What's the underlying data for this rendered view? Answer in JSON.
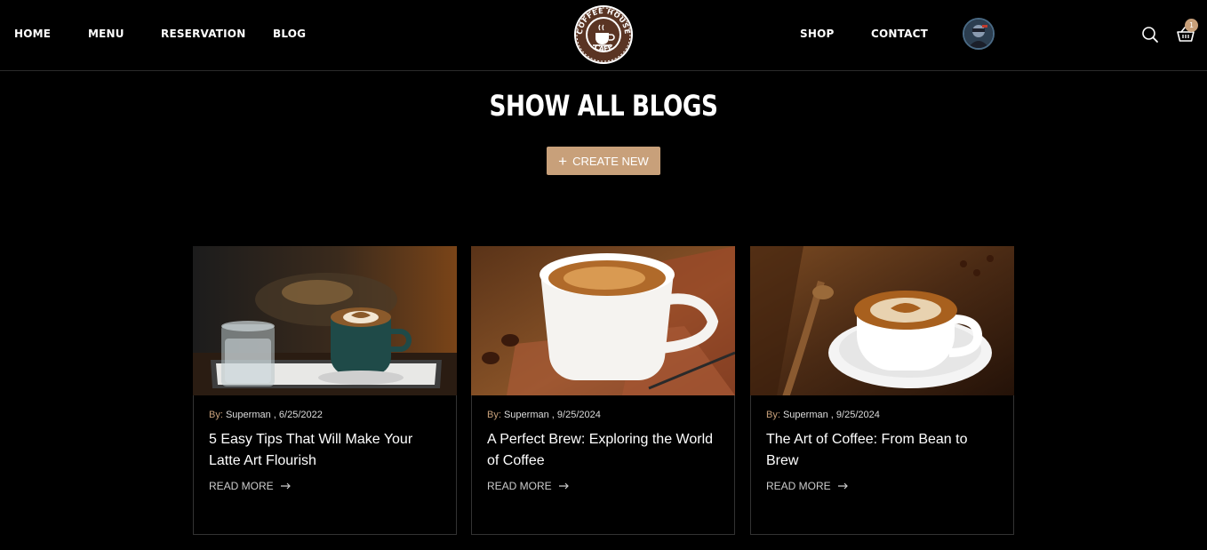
{
  "nav": {
    "left": [
      {
        "id": "home",
        "label": "HOME"
      },
      {
        "id": "menu",
        "label": "MENU"
      },
      {
        "id": "reservation",
        "label": "RESERVATION"
      },
      {
        "id": "blog",
        "label": "BLOG"
      }
    ],
    "right": [
      {
        "id": "shop",
        "label": "SHOP"
      },
      {
        "id": "contact",
        "label": "CONTACT"
      }
    ],
    "logo": {
      "top_text": "COFFEE HOUSE",
      "bottom_text": "CAFE"
    },
    "cart_count": "1",
    "icons": {
      "search": "search-icon",
      "cart": "cart-icon",
      "avatar": "avatar"
    }
  },
  "page": {
    "title": "SHOW ALL BLOGS",
    "create_button": "CREATE NEW",
    "create_icon": "+"
  },
  "blogs": [
    {
      "by_label": "By:",
      "author": "Superman",
      "date": "6/25/2022",
      "title": "5 Easy Tips That Will Make Your Latte Art Flourish",
      "read_more": "READ MORE"
    },
    {
      "by_label": "By:",
      "author": "Superman",
      "date": "9/25/2024",
      "title": "A Perfect Brew: Exploring the World of Coffee",
      "read_more": "READ MORE"
    },
    {
      "by_label": "By:",
      "author": "Superman",
      "date": "9/25/2024",
      "title": "The Art of Coffee: From Bean to Brew",
      "read_more": "READ MORE"
    }
  ],
  "colors": {
    "accent": "#c8a07a",
    "background": "#000000",
    "card_border": "#333333"
  }
}
